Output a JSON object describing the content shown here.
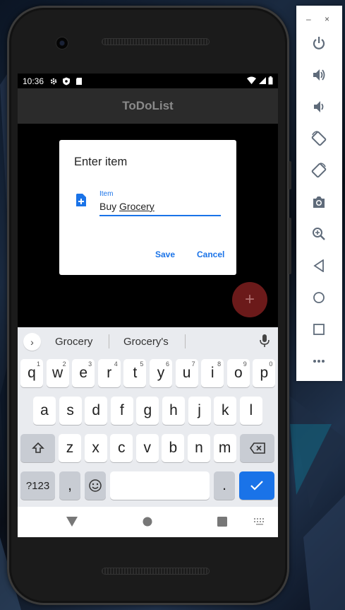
{
  "status_bar": {
    "time": "10:36"
  },
  "app": {
    "title": "ToDoList"
  },
  "dialog": {
    "title": "Enter item",
    "field_label": "Item",
    "field_value_prefix": "Buy ",
    "field_value_word": "Grocery",
    "save_label": "Save",
    "cancel_label": "Cancel"
  },
  "fab": {
    "label": "+"
  },
  "keyboard": {
    "suggestions": [
      "Grocery",
      "Grocery's"
    ],
    "row1": [
      {
        "k": "q",
        "h": "1"
      },
      {
        "k": "w",
        "h": "2"
      },
      {
        "k": "e",
        "h": "3"
      },
      {
        "k": "r",
        "h": "4"
      },
      {
        "k": "t",
        "h": "5"
      },
      {
        "k": "y",
        "h": "6"
      },
      {
        "k": "u",
        "h": "7"
      },
      {
        "k": "i",
        "h": "8"
      },
      {
        "k": "o",
        "h": "9"
      },
      {
        "k": "p",
        "h": "0"
      }
    ],
    "row2": [
      "a",
      "s",
      "d",
      "f",
      "g",
      "h",
      "j",
      "k",
      "l"
    ],
    "row3": [
      "z",
      "x",
      "c",
      "v",
      "b",
      "n",
      "m"
    ],
    "symbols_label": "?123",
    "comma_label": ",",
    "period_label": "."
  },
  "toolbar": {
    "minimize_label": "–",
    "close_label": "×",
    "buttons": [
      "power-icon",
      "volume-up-icon",
      "volume-down-icon",
      "rotate-left-icon",
      "rotate-right-icon",
      "camera-icon",
      "zoom-icon",
      "back-icon",
      "home-icon",
      "overview-icon",
      "more-icon"
    ]
  },
  "colors": {
    "accent": "#1a73e8",
    "fab": "#6b1a1a",
    "appbar": "#2b2b2b",
    "keyboard_bg": "#e9ebef"
  }
}
